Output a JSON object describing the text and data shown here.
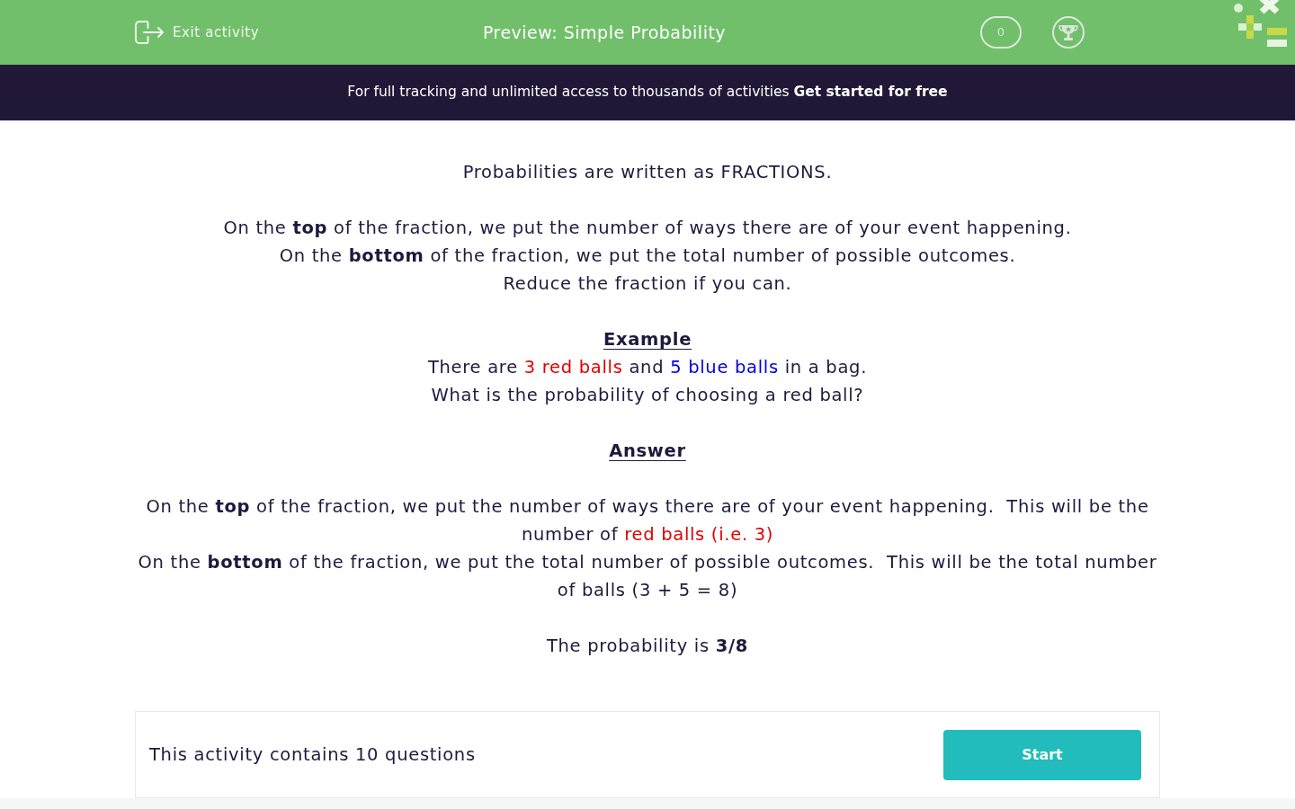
{
  "header": {
    "exit_label": "Exit activity",
    "title": "Preview: Simple Probability",
    "score": "0"
  },
  "banner": {
    "text": "For full tracking and unlimited access to thousands of activities",
    "link": "Get started for free"
  },
  "blocks": [
    {
      "lines": [
        {
          "kind": "text",
          "segments": [
            {
              "text": "Probabilities are written as FRACTIONS."
            }
          ]
        }
      ]
    },
    {
      "lines": [
        {
          "kind": "text",
          "segments": [
            {
              "text": "On the **top** of the fraction, we put the number of ways there are of your event happening."
            }
          ]
        },
        {
          "kind": "text",
          "segments": [
            {
              "text": "On the **bottom** of the fraction, we put the total number of possible outcomes."
            }
          ]
        },
        {
          "kind": "text",
          "segments": [
            {
              "text": "Reduce the fraction if you can."
            }
          ]
        }
      ]
    },
    {
      "lines": [
        {
          "kind": "heading",
          "segments": [
            {
              "text": "Example"
            }
          ]
        },
        {
          "kind": "text",
          "segments": [
            {
              "text": "There are "
            },
            {
              "text": "3 red balls",
              "color": "#e00000"
            },
            {
              "text": " and "
            },
            {
              "text": "5 blue balls",
              "color": "#0000e0"
            },
            {
              "text": " in a bag."
            }
          ]
        },
        {
          "kind": "text",
          "segments": [
            {
              "text": "What is the probability of choosing a red ball?"
            }
          ]
        }
      ]
    },
    {
      "lines": [
        {
          "kind": "heading",
          "segments": [
            {
              "text": "Answer"
            }
          ]
        }
      ]
    },
    {
      "lines": [
        {
          "kind": "text",
          "segments": [
            {
              "text": "On the **top** of the fraction, we put the number of ways there are of your event happening.  This will be the number of "
            },
            {
              "text": "red balls (i.e. 3)",
              "color": "#e00000"
            }
          ]
        },
        {
          "kind": "text",
          "segments": [
            {
              "text": "On the **bottom** of the fraction, we put the total number of possible outcomes.  This will be the total number of balls (3 + 5 = 8)"
            }
          ]
        }
      ]
    },
    {
      "lines": [
        {
          "kind": "text",
          "segments": [
            {
              "text": "The probability is **3/8**"
            }
          ]
        }
      ]
    }
  ],
  "footer": {
    "text": "This activity contains 10 questions",
    "button": "Start"
  }
}
